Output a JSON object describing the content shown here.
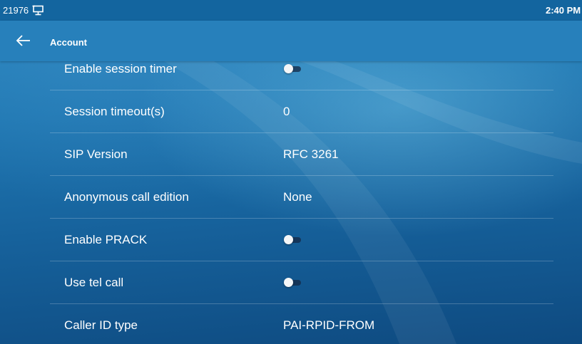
{
  "status_bar": {
    "extension": "21976",
    "pc_icon": "desktop-monitor-icon",
    "time": "2:40 PM"
  },
  "title_bar": {
    "back_icon": "arrow-left-icon",
    "title": "Account"
  },
  "settings": {
    "enable_session_timer": {
      "label": "Enable session timer",
      "enabled": false
    },
    "session_timeout": {
      "label": "Session timeout(s)",
      "value": "0"
    },
    "sip_version": {
      "label": "SIP Version",
      "value": "RFC 3261"
    },
    "anonymous_call_edition": {
      "label": "Anonymous call edition",
      "value": "None"
    },
    "enable_prack": {
      "label": "Enable PRACK",
      "enabled": false
    },
    "use_tel_call": {
      "label": "Use tel call",
      "enabled": false
    },
    "caller_id_type": {
      "label": "Caller ID type",
      "value": "PAI-RPID-FROM"
    }
  },
  "colors": {
    "status_bar": "#13659f",
    "title_bar": "#2780bb",
    "text": "#ffffff",
    "toggle_thumb": "#f4f6f8"
  }
}
